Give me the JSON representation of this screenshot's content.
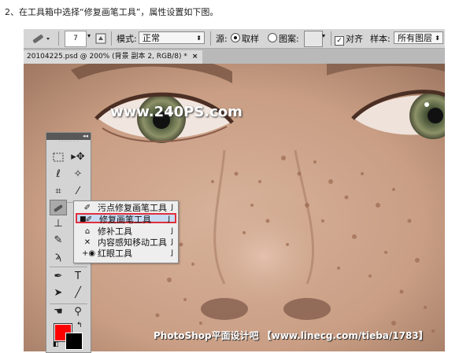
{
  "instruction": "2、在工具箱中选择“修复画笔工具”，属性设置如下图。",
  "options_bar": {
    "brush_size": "7",
    "mode_label": "模式:",
    "mode_value": "正常",
    "source_label": "源:",
    "sampled_label": "取样",
    "pattern_label": "图案:",
    "aligned_label": "对齐",
    "sample_label": "样本:",
    "sample_value": "所有图层"
  },
  "document_tab": {
    "title": "20104225.psd @ 200% (背景 副本 2, RGB/8) *",
    "close": "×"
  },
  "canvas": {
    "watermark": "www.240PS.com",
    "footer": "PhotoShop平面设计吧 【www.linecg.com/tieba/1783】"
  },
  "toolbox": {
    "collapse": "◂◂",
    "fg_color": "#ff0000",
    "bg_color": "#000000"
  },
  "flyout": {
    "items": [
      {
        "label": "污点修复画笔工具",
        "key": "J",
        "icon": "spot-healing-brush-icon"
      },
      {
        "label": "修复画笔工具",
        "key": "J",
        "icon": "healing-brush-icon"
      },
      {
        "label": "修补工具",
        "key": "J",
        "icon": "patch-icon"
      },
      {
        "label": "内容感知移动工具",
        "key": "J",
        "icon": "content-aware-move-icon"
      },
      {
        "label": "红眼工具",
        "key": "J",
        "icon": "red-eye-icon"
      }
    ]
  }
}
